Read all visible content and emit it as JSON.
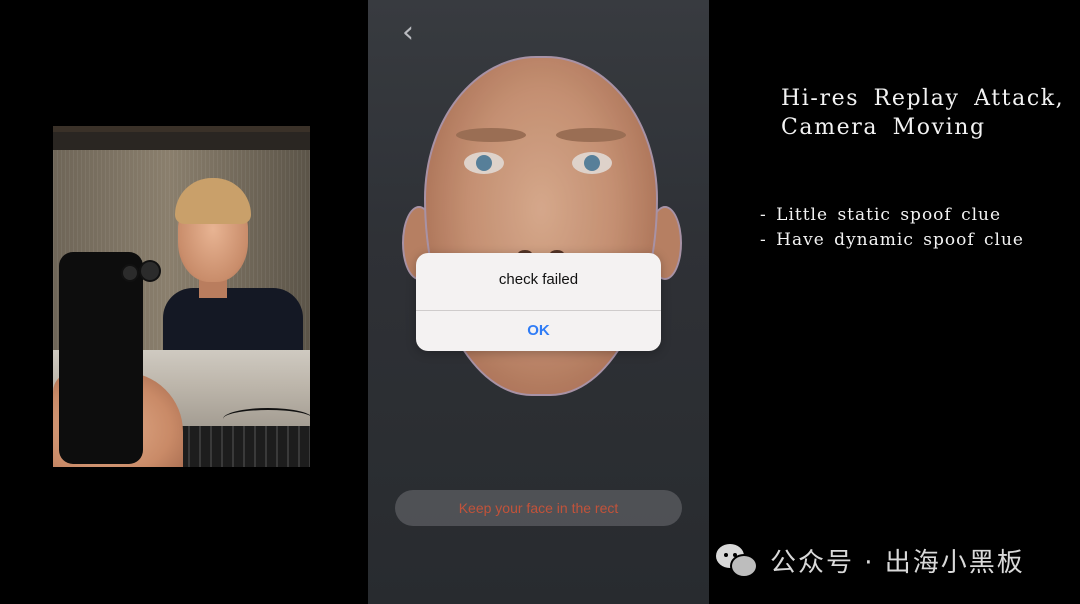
{
  "dialog": {
    "title": "check failed",
    "ok_label": "OK"
  },
  "phone": {
    "back_icon": "chevron-left-icon",
    "hint_text": "Keep your face in the rect"
  },
  "caption": {
    "title_line1": "Hi-res Replay Attack,",
    "title_line2": "Camera Moving",
    "bullets": [
      "Little static spoof clue",
      "Have dynamic spoof clue"
    ]
  },
  "watermark": {
    "text": "公众号 · 出海小黑板",
    "icon": "wechat-icon"
  },
  "colors": {
    "dialog_ok": "#2f7cf6",
    "hint_text": "#d35a3f",
    "face_outline": "#b79fb3",
    "caption_text": "#f3f3f3"
  }
}
